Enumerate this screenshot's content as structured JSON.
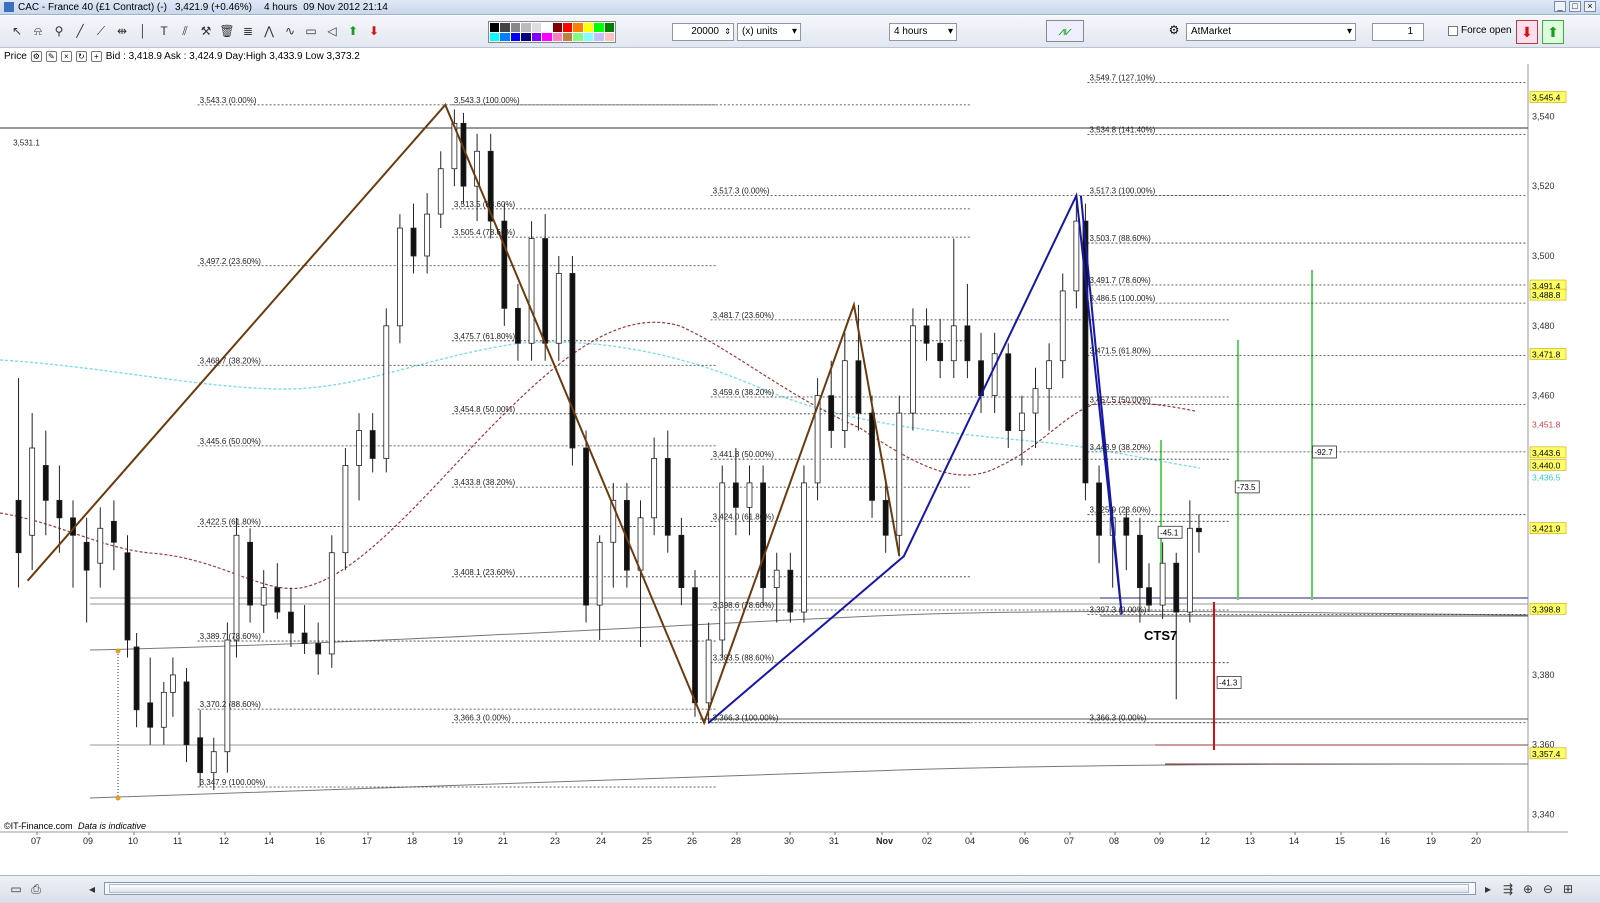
{
  "window": {
    "title": "CAC - France 40 (£1 Contract) (-)",
    "last": "3,421.9 (+0.46%)",
    "interval": "4 hours",
    "datetime": "09 Nov 2012 21:14"
  },
  "toolbar": {
    "quantity": "20000",
    "unit": "(x) units",
    "timeframe": "4 hours",
    "order_type": "AtMarket",
    "qty_small": "1",
    "force_open": "Force open"
  },
  "pricebar": {
    "label": "Price",
    "quote": "Bid : 3,418.9 Ask : 3,424.9 Day:High 3,433.9 Low 3,373.2"
  },
  "footer": {
    "source": "©IT-Finance.com",
    "note": "Data is indicative"
  },
  "colors": {
    "pattern_brown": "#6b3a0e",
    "pattern_blue": "#1717a6",
    "ma_cyan": "#7fdcec",
    "ma_red": "#9a3b3b",
    "green_bar": "#5fd35f",
    "red_bar": "#d41010",
    "price_tag": "#ffff66"
  },
  "chart_data": {
    "type": "candlestick",
    "y_range": [
      3335,
      3555
    ],
    "y_ticks": [
      "3,540",
      "3,520",
      "3,500",
      "3,480",
      "3,460",
      "3,380",
      "3,360",
      "3,340"
    ],
    "x_labels": [
      "07",
      "09",
      "10",
      "11",
      "12",
      "14",
      "16",
      "17",
      "18",
      "19",
      "21",
      "23",
      "24",
      "25",
      "26",
      "28",
      "30",
      "31",
      "Nov",
      "02",
      "04",
      "06",
      "07",
      "08",
      "09",
      "12",
      "13",
      "14",
      "15",
      "16",
      "19",
      "20"
    ],
    "price_tags": [
      {
        "text": "3,545.4",
        "value": 3545.4,
        "style": "yellow"
      },
      {
        "text": "3,491.4",
        "value": 3491.4,
        "style": "yellow"
      },
      {
        "text": "3,488.8",
        "value": 3488.8,
        "style": "yellow"
      },
      {
        "text": "3,471.8",
        "value": 3471.8,
        "style": "yellow"
      },
      {
        "text": "3,451.8",
        "value": 3451.8,
        "style": "red"
      },
      {
        "text": "3,443.6",
        "value": 3443.6,
        "style": "yellow"
      },
      {
        "text": "3,440.0",
        "value": 3440.0,
        "style": "yellow"
      },
      {
        "text": "3,436.5",
        "value": 3436.5,
        "style": "cyan"
      },
      {
        "text": "3,421.9",
        "value": 3421.9,
        "style": "yellow"
      },
      {
        "text": "3,398.8",
        "value": 3398.8,
        "style": "yellow"
      },
      {
        "text": "3,357.4",
        "value": 3357.4,
        "style": "yellow"
      }
    ],
    "annotations": [
      {
        "text": "3,531.1",
        "at": [
          0.2,
          3531.1
        ]
      },
      {
        "text": "3,543.3 (0.00%)",
        "at": [
          4,
          3543.3
        ]
      },
      {
        "text": "3,543.3 (100.00%)",
        "at": [
          9.6,
          3543.3
        ]
      },
      {
        "text": "3,497.2 (23.60%)",
        "at": [
          4,
          3497.2
        ]
      },
      {
        "text": "3,468.7 (38.20%)",
        "at": [
          4,
          3468.7
        ]
      },
      {
        "text": "3,445.6 (50.00%)",
        "at": [
          4,
          3445.6
        ]
      },
      {
        "text": "3,422.5 (61.80%)",
        "at": [
          4,
          3422.5
        ]
      },
      {
        "text": "3,389.7 (78.60%)",
        "at": [
          4,
          3389.7
        ]
      },
      {
        "text": "3,370.2 (88.60%)",
        "at": [
          4,
          3370.2
        ]
      },
      {
        "text": "3,347.9 (100.00%)",
        "at": [
          4,
          3347.9
        ]
      },
      {
        "text": "3,513.5 (88.60%)",
        "at": [
          9.6,
          3513.5
        ]
      },
      {
        "text": "3,505.4 (78.60%)",
        "at": [
          9.6,
          3505.4
        ]
      },
      {
        "text": "3,475.7 (61.80%)",
        "at": [
          9.6,
          3475.7
        ]
      },
      {
        "text": "3,454.8 (50.00%)",
        "at": [
          9.6,
          3454.8
        ]
      },
      {
        "text": "3,433.8 (38.20%)",
        "at": [
          9.6,
          3433.8
        ]
      },
      {
        "text": "3,408.1 (23.60%)",
        "at": [
          9.6,
          3408.1
        ]
      },
      {
        "text": "3,366.3 (0.00%)",
        "at": [
          9.6,
          3366.3
        ]
      },
      {
        "text": "3,517.3 (0.00%)",
        "at": [
          15.3,
          3517.3
        ]
      },
      {
        "text": "3,481.7 (23.60%)",
        "at": [
          15.3,
          3481.7
        ]
      },
      {
        "text": "3,459.6 (38.20%)",
        "at": [
          15.3,
          3459.6
        ]
      },
      {
        "text": "3,441.8 (50.00%)",
        "at": [
          15.3,
          3441.8
        ]
      },
      {
        "text": "3,424.0 (61.80%)",
        "at": [
          15.3,
          3424.0
        ]
      },
      {
        "text": "3,398.6 (78.60%)",
        "at": [
          15.3,
          3398.6
        ]
      },
      {
        "text": "3,383.5 (88.60%)",
        "at": [
          15.3,
          3383.5
        ]
      },
      {
        "text": "3,366.3 (100.00%)",
        "at": [
          15.3,
          3366.3
        ]
      },
      {
        "text": "3,549.7 (127.10%)",
        "at": [
          23.6,
          3549.7
        ]
      },
      {
        "text": "3,534.8 (141.40%)",
        "at": [
          23.6,
          3534.8
        ]
      },
      {
        "text": "3,517.3 (100.00%)",
        "at": [
          23.6,
          3517.3
        ]
      },
      {
        "text": "3,503.7 (88.60%)",
        "at": [
          23.6,
          3503.7
        ]
      },
      {
        "text": "3,491.7 (78.60%)",
        "at": [
          23.6,
          3491.7
        ]
      },
      {
        "text": "3,486.5 (100.00%)",
        "at": [
          23.6,
          3486.5
        ]
      },
      {
        "text": "3,471.5 (61.80%)",
        "at": [
          23.6,
          3471.5
        ]
      },
      {
        "text": "3,457.5 (50.00%)",
        "at": [
          23.6,
          3457.5
        ]
      },
      {
        "text": "3,443.9 (38.20%)",
        "at": [
          23.6,
          3443.9
        ]
      },
      {
        "text": "3,425.9 (23.60%)",
        "at": [
          23.6,
          3425.9
        ]
      },
      {
        "text": "3,397.3 (0.00%)",
        "at": [
          23.6,
          3397.3
        ]
      },
      {
        "text": "3,366.3 (0.00%)",
        "at": [
          23.6,
          3366.3
        ]
      }
    ],
    "boxes": [
      {
        "text": "-45.1",
        "at": [
          25.2,
          3420
        ]
      },
      {
        "text": "-73.5",
        "at": [
          26.9,
          3433
        ]
      },
      {
        "text": "-92.7",
        "at": [
          28.6,
          3443
        ]
      },
      {
        "text": "-41.3",
        "at": [
          26.5,
          3377
        ]
      }
    ],
    "pattern_label": "CTS7",
    "brown_pattern": [
      [
        0.3,
        3407
      ],
      [
        9.5,
        3543.3
      ],
      [
        15.2,
        3366.3
      ],
      [
        18.5,
        3486
      ],
      [
        19.5,
        3414
      ]
    ],
    "blue_pattern": [
      [
        15.3,
        3366.3
      ],
      [
        19.6,
        3414
      ],
      [
        23.4,
        3517.3
      ],
      [
        24.4,
        3397.3
      ],
      [
        23.5,
        3517.3
      ]
    ],
    "candles": [
      {
        "x": 0.1,
        "o": 3430,
        "h": 3465,
        "l": 3405,
        "c": 3415
      },
      {
        "x": 0.4,
        "o": 3420,
        "h": 3455,
        "l": 3410,
        "c": 3445
      },
      {
        "x": 0.7,
        "o": 3440,
        "h": 3450,
        "l": 3420,
        "c": 3430
      },
      {
        "x": 1.0,
        "o": 3430,
        "h": 3440,
        "l": 3415,
        "c": 3425
      },
      {
        "x": 1.3,
        "o": 3425,
        "h": 3430,
        "l": 3405,
        "c": 3420
      },
      {
        "x": 1.6,
        "o": 3418,
        "h": 3425,
        "l": 3395,
        "c": 3410
      },
      {
        "x": 1.9,
        "o": 3412,
        "h": 3428,
        "l": 3405,
        "c": 3422
      },
      {
        "x": 2.2,
        "o": 3424,
        "h": 3430,
        "l": 3410,
        "c": 3418
      },
      {
        "x": 2.5,
        "o": 3415,
        "h": 3420,
        "l": 3385,
        "c": 3390
      },
      {
        "x": 2.7,
        "o": 3388,
        "h": 3392,
        "l": 3365,
        "c": 3370
      },
      {
        "x": 3.0,
        "o": 3372,
        "h": 3385,
        "l": 3360,
        "c": 3365
      },
      {
        "x": 3.3,
        "o": 3365,
        "h": 3378,
        "l": 3360,
        "c": 3375
      },
      {
        "x": 3.5,
        "o": 3375,
        "h": 3385,
        "l": 3368,
        "c": 3380
      },
      {
        "x": 3.8,
        "o": 3378,
        "h": 3382,
        "l": 3355,
        "c": 3360
      },
      {
        "x": 4.1,
        "o": 3362,
        "h": 3370,
        "l": 3348,
        "c": 3352
      },
      {
        "x": 4.4,
        "o": 3352,
        "h": 3362,
        "l": 3347,
        "c": 3358
      },
      {
        "x": 4.7,
        "o": 3358,
        "h": 3395,
        "l": 3352,
        "c": 3390
      },
      {
        "x": 4.9,
        "o": 3390,
        "h": 3425,
        "l": 3385,
        "c": 3420
      },
      {
        "x": 5.2,
        "o": 3418,
        "h": 3422,
        "l": 3395,
        "c": 3400
      },
      {
        "x": 5.5,
        "o": 3400,
        "h": 3410,
        "l": 3392,
        "c": 3405
      },
      {
        "x": 5.8,
        "o": 3405,
        "h": 3412,
        "l": 3396,
        "c": 3398
      },
      {
        "x": 6.1,
        "o": 3398,
        "h": 3405,
        "l": 3388,
        "c": 3392
      },
      {
        "x": 6.4,
        "o": 3392,
        "h": 3400,
        "l": 3386,
        "c": 3389
      },
      {
        "x": 6.7,
        "o": 3389,
        "h": 3395,
        "l": 3380,
        "c": 3386
      },
      {
        "x": 7.0,
        "o": 3386,
        "h": 3420,
        "l": 3382,
        "c": 3415
      },
      {
        "x": 7.3,
        "o": 3415,
        "h": 3445,
        "l": 3410,
        "c": 3440
      },
      {
        "x": 7.6,
        "o": 3440,
        "h": 3455,
        "l": 3430,
        "c": 3450
      },
      {
        "x": 7.9,
        "o": 3450,
        "h": 3455,
        "l": 3438,
        "c": 3442
      },
      {
        "x": 8.2,
        "o": 3442,
        "h": 3485,
        "l": 3438,
        "c": 3480
      },
      {
        "x": 8.5,
        "o": 3480,
        "h": 3512,
        "l": 3475,
        "c": 3508
      },
      {
        "x": 8.8,
        "o": 3508,
        "h": 3515,
        "l": 3495,
        "c": 3500
      },
      {
        "x": 9.1,
        "o": 3500,
        "h": 3518,
        "l": 3495,
        "c": 3512
      },
      {
        "x": 9.4,
        "o": 3512,
        "h": 3530,
        "l": 3508,
        "c": 3525
      },
      {
        "x": 9.7,
        "o": 3525,
        "h": 3542,
        "l": 3520,
        "c": 3538
      },
      {
        "x": 9.9,
        "o": 3538,
        "h": 3541,
        "l": 3515,
        "c": 3520
      },
      {
        "x": 10.2,
        "o": 3520,
        "h": 3535,
        "l": 3510,
        "c": 3530
      },
      {
        "x": 10.5,
        "o": 3530,
        "h": 3535,
        "l": 3505,
        "c": 3510
      },
      {
        "x": 10.8,
        "o": 3510,
        "h": 3515,
        "l": 3480,
        "c": 3485
      },
      {
        "x": 11.1,
        "o": 3485,
        "h": 3492,
        "l": 3470,
        "c": 3475
      },
      {
        "x": 11.4,
        "o": 3475,
        "h": 3510,
        "l": 3470,
        "c": 3505
      },
      {
        "x": 11.7,
        "o": 3505,
        "h": 3512,
        "l": 3470,
        "c": 3475
      },
      {
        "x": 12.0,
        "o": 3475,
        "h": 3500,
        "l": 3470,
        "c": 3495
      },
      {
        "x": 12.3,
        "o": 3495,
        "h": 3500,
        "l": 3440,
        "c": 3445
      },
      {
        "x": 12.6,
        "o": 3445,
        "h": 3450,
        "l": 3395,
        "c": 3400
      },
      {
        "x": 12.9,
        "o": 3400,
        "h": 3420,
        "l": 3390,
        "c": 3418
      },
      {
        "x": 13.2,
        "o": 3418,
        "h": 3435,
        "l": 3405,
        "c": 3430
      },
      {
        "x": 13.5,
        "o": 3430,
        "h": 3435,
        "l": 3405,
        "c": 3410
      },
      {
        "x": 13.8,
        "o": 3410,
        "h": 3430,
        "l": 3388,
        "c": 3425
      },
      {
        "x": 14.1,
        "o": 3425,
        "h": 3448,
        "l": 3420,
        "c": 3442
      },
      {
        "x": 14.4,
        "o": 3442,
        "h": 3450,
        "l": 3415,
        "c": 3420
      },
      {
        "x": 14.7,
        "o": 3420,
        "h": 3425,
        "l": 3400,
        "c": 3405
      },
      {
        "x": 15.0,
        "o": 3405,
        "h": 3410,
        "l": 3368,
        "c": 3372
      },
      {
        "x": 15.3,
        "o": 3372,
        "h": 3395,
        "l": 3366,
        "c": 3390
      },
      {
        "x": 15.6,
        "o": 3390,
        "h": 3440,
        "l": 3385,
        "c": 3435
      },
      {
        "x": 15.9,
        "o": 3435,
        "h": 3445,
        "l": 3420,
        "c": 3428
      },
      {
        "x": 16.2,
        "o": 3428,
        "h": 3440,
        "l": 3420,
        "c": 3435
      },
      {
        "x": 16.5,
        "o": 3435,
        "h": 3440,
        "l": 3400,
        "c": 3405
      },
      {
        "x": 16.8,
        "o": 3405,
        "h": 3415,
        "l": 3395,
        "c": 3410
      },
      {
        "x": 17.1,
        "o": 3410,
        "h": 3415,
        "l": 3395,
        "c": 3398
      },
      {
        "x": 17.4,
        "o": 3398,
        "h": 3440,
        "l": 3395,
        "c": 3435
      },
      {
        "x": 17.7,
        "o": 3435,
        "h": 3465,
        "l": 3430,
        "c": 3460
      },
      {
        "x": 18.0,
        "o": 3460,
        "h": 3470,
        "l": 3445,
        "c": 3450
      },
      {
        "x": 18.3,
        "o": 3450,
        "h": 3478,
        "l": 3445,
        "c": 3470
      },
      {
        "x": 18.6,
        "o": 3470,
        "h": 3486,
        "l": 3450,
        "c": 3455
      },
      {
        "x": 18.9,
        "o": 3455,
        "h": 3460,
        "l": 3425,
        "c": 3430
      },
      {
        "x": 19.2,
        "o": 3430,
        "h": 3435,
        "l": 3415,
        "c": 3420
      },
      {
        "x": 19.5,
        "o": 3420,
        "h": 3460,
        "l": 3414,
        "c": 3455
      },
      {
        "x": 19.8,
        "o": 3455,
        "h": 3485,
        "l": 3450,
        "c": 3480
      },
      {
        "x": 20.1,
        "o": 3480,
        "h": 3485,
        "l": 3470,
        "c": 3475
      },
      {
        "x": 20.4,
        "o": 3475,
        "h": 3482,
        "l": 3465,
        "c": 3470
      },
      {
        "x": 20.7,
        "o": 3470,
        "h": 3505,
        "l": 3465,
        "c": 3480
      },
      {
        "x": 21.0,
        "o": 3480,
        "h": 3492,
        "l": 3465,
        "c": 3470
      },
      {
        "x": 21.3,
        "o": 3470,
        "h": 3478,
        "l": 3455,
        "c": 3460
      },
      {
        "x": 21.6,
        "o": 3460,
        "h": 3478,
        "l": 3455,
        "c": 3472
      },
      {
        "x": 21.9,
        "o": 3472,
        "h": 3475,
        "l": 3445,
        "c": 3450
      },
      {
        "x": 22.2,
        "o": 3450,
        "h": 3460,
        "l": 3440,
        "c": 3455
      },
      {
        "x": 22.5,
        "o": 3455,
        "h": 3468,
        "l": 3445,
        "c": 3462
      },
      {
        "x": 22.8,
        "o": 3462,
        "h": 3475,
        "l": 3450,
        "c": 3470
      },
      {
        "x": 23.1,
        "o": 3470,
        "h": 3495,
        "l": 3465,
        "c": 3490
      },
      {
        "x": 23.4,
        "o": 3490,
        "h": 3517,
        "l": 3485,
        "c": 3510
      },
      {
        "x": 23.6,
        "o": 3510,
        "h": 3515,
        "l": 3430,
        "c": 3435
      },
      {
        "x": 23.9,
        "o": 3435,
        "h": 3440,
        "l": 3412,
        "c": 3420
      },
      {
        "x": 24.2,
        "o": 3420,
        "h": 3428,
        "l": 3405,
        "c": 3425
      },
      {
        "x": 24.5,
        "o": 3425,
        "h": 3428,
        "l": 3410,
        "c": 3420
      },
      {
        "x": 24.8,
        "o": 3420,
        "h": 3425,
        "l": 3395,
        "c": 3405
      },
      {
        "x": 25.0,
        "o": 3405,
        "h": 3412,
        "l": 3398,
        "c": 3400
      },
      {
        "x": 25.3,
        "o": 3400,
        "h": 3418,
        "l": 3396,
        "c": 3412
      },
      {
        "x": 25.6,
        "o": 3412,
        "h": 3415,
        "l": 3373,
        "c": 3398
      },
      {
        "x": 25.9,
        "o": 3398,
        "h": 3430,
        "l": 3395,
        "c": 3422
      },
      {
        "x": 26.1,
        "o": 3422,
        "h": 3426,
        "l": 3415,
        "c": 3421
      }
    ]
  }
}
